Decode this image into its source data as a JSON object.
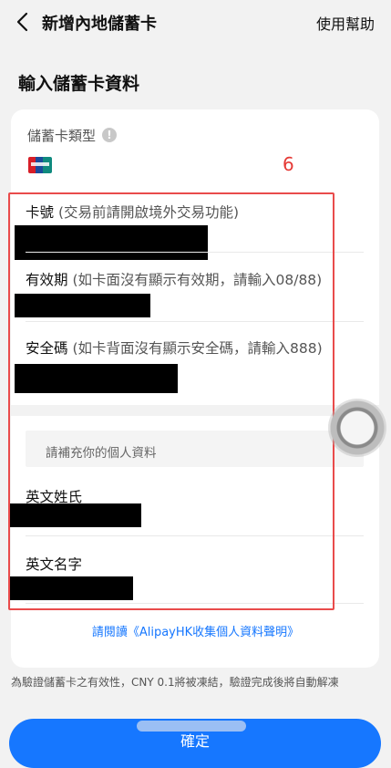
{
  "header": {
    "title": "新增內地儲蓄卡",
    "help": "使用幫助"
  },
  "section_title": "輸入儲蓄卡資料",
  "card_type": {
    "label": "儲蓄卡類型",
    "info": "!",
    "logo_icon": "unionpay-logo-icon"
  },
  "annotation_number": "6",
  "fields": {
    "card_number": {
      "label": "卡號",
      "hint": "(交易前請開啟境外交易功能)"
    },
    "expiry": {
      "label": "有效期",
      "hint": "(如卡面沒有顯示有效期，請輸入08/88)"
    },
    "security_code": {
      "label": "安全碼",
      "hint": "(如卡背面沒有顯示安全碼，請輸入888)"
    }
  },
  "personal": {
    "section_label": "請補充你的個人資料",
    "surname_label": "英文姓氏",
    "given_name_label": "英文名字"
  },
  "consent_link": "請閱讀《AlipayHK收集個人資料聲明》",
  "notice": "為驗證儲蓄卡之有效性，CNY 0.1將被凍結，驗證完成後將自動解凍",
  "confirm_button": "確定",
  "colors": {
    "primary": "#1677ff",
    "annotation": "#e94b4b",
    "background": "#f2f2f2"
  }
}
